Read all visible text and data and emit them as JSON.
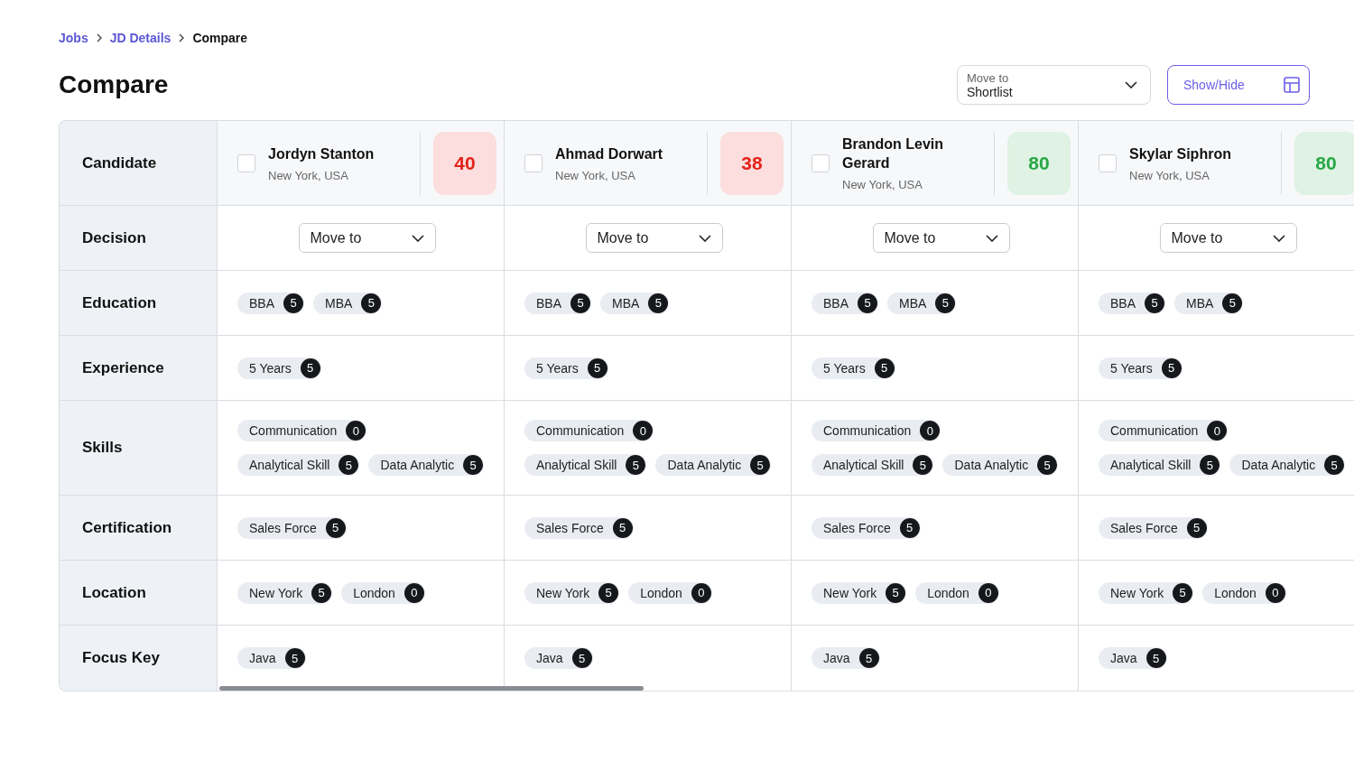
{
  "breadcrumbs": [
    {
      "label": "Jobs",
      "current": false
    },
    {
      "label": "JD Details",
      "current": false
    },
    {
      "label": "Compare",
      "current": true
    }
  ],
  "title": "Compare",
  "bulk_action": {
    "label": "Move to",
    "value": "Shortlist"
  },
  "show_hide_button": {
    "label": "Show/Hide"
  },
  "table": {
    "row_labels": [
      "Candidate",
      "Decision",
      "Education",
      "Experience",
      "Skills",
      "Certification",
      "Location",
      "Focus Key"
    ],
    "candidates": [
      {
        "name": "Jordyn Stanton",
        "location": "New York, USA",
        "checked": false,
        "score": "40",
        "color": "#e2231a",
        "decision": "Move to",
        "criteria": [
          [
            {
              "label": "BBA",
              "count": "5"
            },
            {
              "label": "MBA",
              "count": "5"
            }
          ],
          [
            {
              "label": "5 Years",
              "count": "5"
            }
          ],
          [
            {
              "label": "Communication",
              "count": "0"
            },
            {
              "label": "Analytical Skill",
              "count": "5"
            },
            {
              "label": "Data Analytic",
              "count": "5"
            }
          ],
          [
            {
              "label": "Sales Force",
              "count": "5"
            }
          ],
          [
            {
              "label": "New York",
              "count": "5"
            },
            {
              "label": "London",
              "count": "0"
            }
          ],
          [
            {
              "label": "Java",
              "count": "5"
            }
          ]
        ]
      },
      {
        "name": "Ahmad Dorwart",
        "location": "New York, USA",
        "checked": false,
        "score": "38",
        "color": "#e2231a",
        "decision": "Move to",
        "criteria": [
          [
            {
              "label": "BBA",
              "count": "5"
            },
            {
              "label": "MBA",
              "count": "5"
            }
          ],
          [
            {
              "label": "5 Years",
              "count": "5"
            }
          ],
          [
            {
              "label": "Communication",
              "count": "0"
            },
            {
              "label": "Analytical Skill",
              "count": "5"
            },
            {
              "label": "Data Analytic",
              "count": "5"
            }
          ],
          [
            {
              "label": "Sales Force",
              "count": "5"
            }
          ],
          [
            {
              "label": "New York",
              "count": "5"
            },
            {
              "label": "London",
              "count": "0"
            }
          ],
          [
            {
              "label": "Java",
              "count": "5"
            }
          ]
        ]
      },
      {
        "name": "Brandon Levin Gerard",
        "location": "New York, USA",
        "checked": false,
        "score": "80",
        "color": "#28a745",
        "decision": "Move to",
        "criteria": [
          [
            {
              "label": "BBA",
              "count": "5"
            },
            {
              "label": "MBA",
              "count": "5"
            }
          ],
          [
            {
              "label": "5 Years",
              "count": "5"
            }
          ],
          [
            {
              "label": "Communication",
              "count": "0"
            },
            {
              "label": "Analytical Skill",
              "count": "5"
            },
            {
              "label": "Data Analytic",
              "count": "5"
            }
          ],
          [
            {
              "label": "Sales Force",
              "count": "5"
            }
          ],
          [
            {
              "label": "New York",
              "count": "5"
            },
            {
              "label": "London",
              "count": "0"
            }
          ],
          [
            {
              "label": "Java",
              "count": "5"
            }
          ]
        ]
      },
      {
        "name": "Skylar Siphron",
        "location": "New York, USA",
        "checked": false,
        "score": "80",
        "color": "#28a745",
        "decision": "Move to",
        "criteria": [
          [
            {
              "label": "BBA",
              "count": "5"
            },
            {
              "label": "MBA",
              "count": "5"
            }
          ],
          [
            {
              "label": "5 Years",
              "count": "5"
            }
          ],
          [
            {
              "label": "Communication",
              "count": "0"
            },
            {
              "label": "Analytical Skill",
              "count": "5"
            },
            {
              "label": "Data Analytic",
              "count": "5"
            }
          ],
          [
            {
              "label": "Sales Force",
              "count": "5"
            }
          ],
          [
            {
              "label": "New York",
              "count": "5"
            },
            {
              "label": "London",
              "count": "0"
            }
          ],
          [
            {
              "label": "Java",
              "count": "5"
            }
          ]
        ]
      }
    ]
  }
}
